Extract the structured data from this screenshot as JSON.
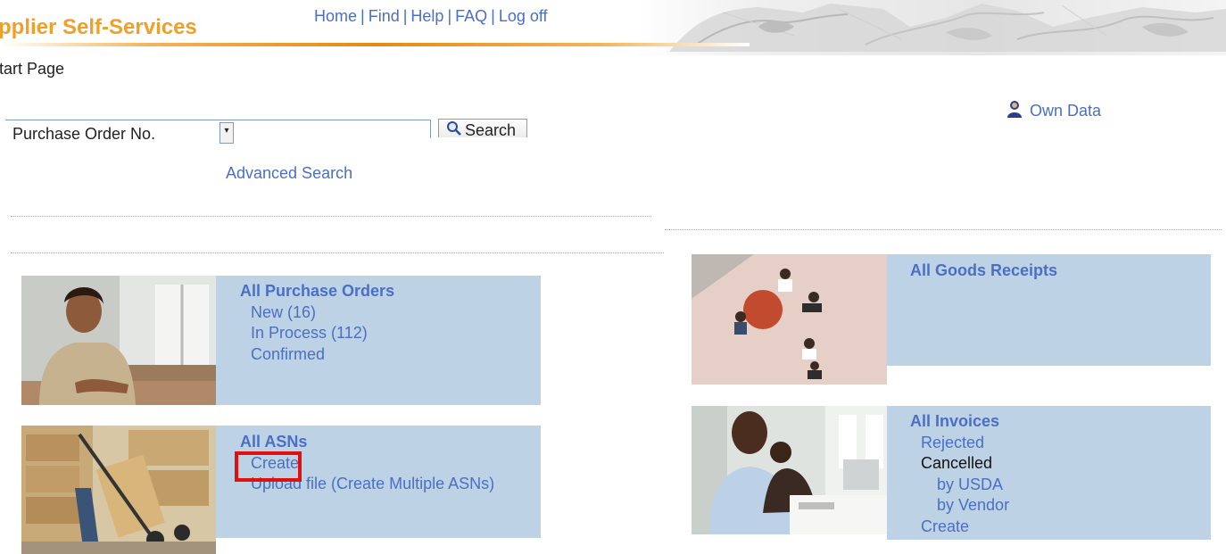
{
  "header": {
    "brand": "pplier Self-Services",
    "nav": [
      "Home",
      "Find",
      "Help",
      "FAQ",
      "Log off"
    ],
    "separator": "|"
  },
  "page_title": "tart Page",
  "own_data": {
    "label": "Own Data",
    "icon": "person-icon"
  },
  "search": {
    "field_value": "Purchase Order No.",
    "input_value": "",
    "button_label": "Search",
    "advanced_label": "Advanced Search"
  },
  "tiles": {
    "purchase_orders": {
      "title": "All Purchase Orders",
      "links": [
        "New (16)",
        "In Process (112)",
        "Confirmed"
      ]
    },
    "asns": {
      "title": "All ASNs",
      "links": [
        "Create",
        "Upload file (Create Multiple ASNs)"
      ]
    },
    "goods_receipts": {
      "title": "All Goods Receipts"
    },
    "invoices": {
      "title": "All Invoices",
      "rejected": "Rejected",
      "cancelled": "Cancelled",
      "by_usda": "by USDA",
      "by_vendor": "by Vendor",
      "create": "Create"
    }
  },
  "colors": {
    "brand_orange": "#f0a028",
    "link_blue": "#4a6fc4",
    "tile_bg": "#bed2e5",
    "highlight_red": "#e01010"
  }
}
